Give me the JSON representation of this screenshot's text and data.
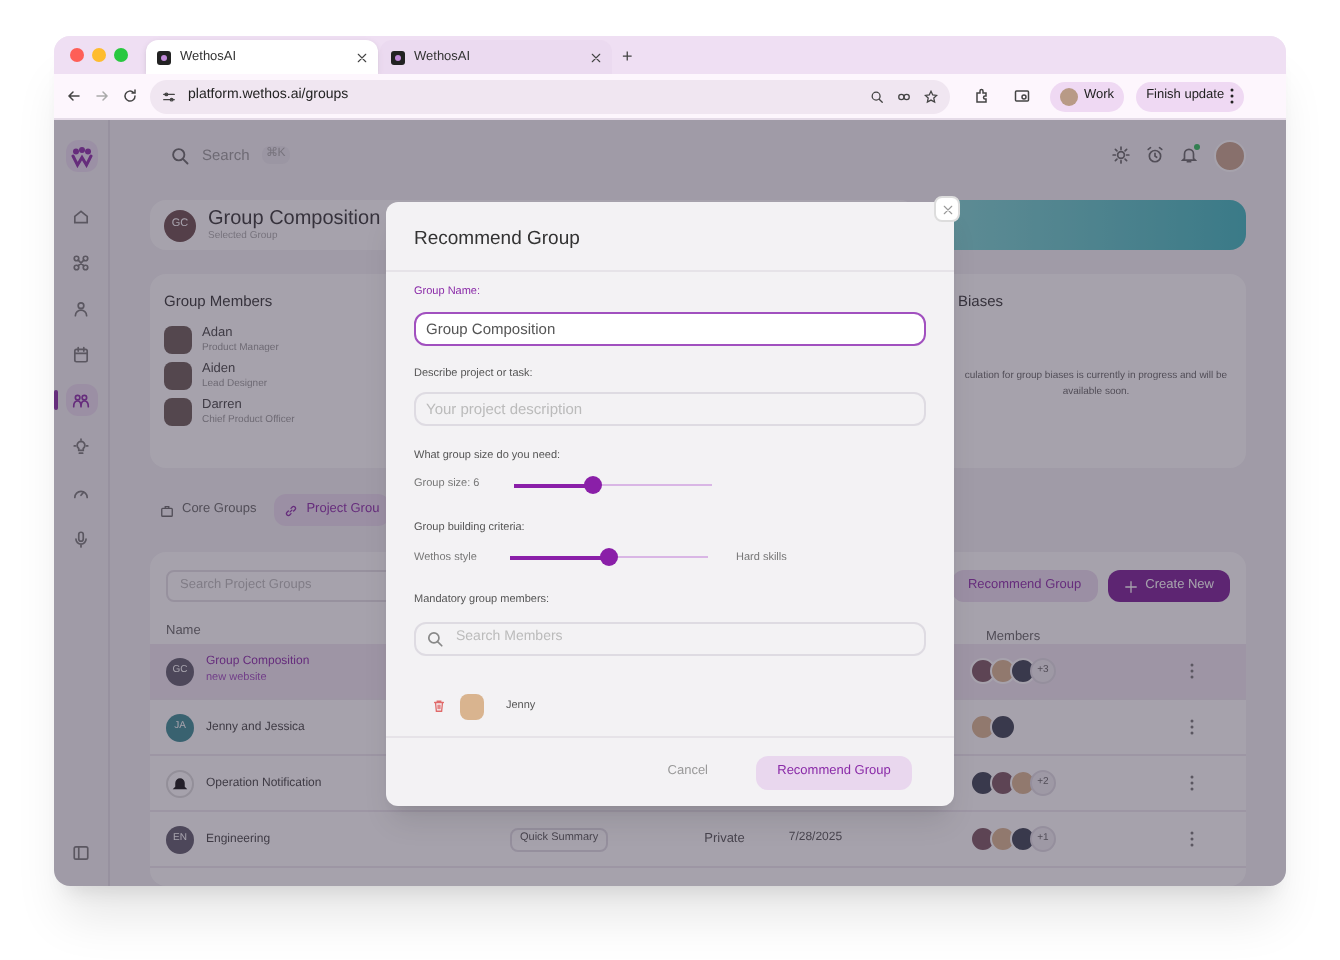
{
  "browser": {
    "tabs": [
      {
        "title": "WethosAI",
        "selected": true
      },
      {
        "title": "WethosAI",
        "selected": false
      }
    ],
    "new_tab": "+",
    "url": "platform.wethos.ai/groups",
    "profile": "Work",
    "update_button": "Finish update"
  },
  "app": {
    "search": {
      "placeholder": "Search",
      "shortcut": "⌘K"
    },
    "sidebar": [
      {
        "kind": "home",
        "selected": false
      },
      {
        "kind": "nodes",
        "selected": false
      },
      {
        "kind": "person",
        "selected": false
      },
      {
        "kind": "calendar",
        "selected": false
      },
      {
        "kind": "people",
        "selected": true
      },
      {
        "kind": "bulb",
        "selected": false
      },
      {
        "kind": "gauge",
        "selected": false
      },
      {
        "kind": "mic",
        "selected": false
      }
    ],
    "selected_group": {
      "initials": "GC",
      "name": "Group Composition",
      "subtitle": "Selected Group"
    },
    "group_members": {
      "title": "Group Members",
      "members": [
        {
          "name": "Adan",
          "role": "Product Manager"
        },
        {
          "name": "Aiden",
          "role": "Lead Designer"
        },
        {
          "name": "Darren",
          "role": "Chief Product Officer"
        }
      ]
    },
    "biases": {
      "title": "Biases",
      "text": "culation for group biases is currently in progress and will be available soon."
    },
    "group_tabs": [
      {
        "label": "Core Groups",
        "selected": false
      },
      {
        "label": "Project Grou",
        "selected": true
      }
    ],
    "table": {
      "search_placeholder": "Search Project Groups",
      "recommend_button": "Recommend Group",
      "create_button": "Create New",
      "columns": [
        "Name",
        "Members"
      ],
      "rows": [
        {
          "kind": "initials",
          "initials": "GC",
          "name": "Group Composition",
          "subtitle": "new website",
          "selected": true,
          "member_photos": [
            {
              "kind": "photo"
            },
            {
              "kind": "photo"
            },
            {
              "kind": "photo"
            }
          ],
          "extra": "+3"
        },
        {
          "kind": "initials",
          "initials": "JA",
          "name": "Jenny and Jessica",
          "selected": false,
          "member_photos": [
            {
              "kind": "photo"
            },
            {
              "kind": "photo"
            }
          ]
        },
        {
          "kind": "bell",
          "name": "Operation Notification",
          "selected": false,
          "member_photos": [
            {
              "kind": "photo"
            },
            {
              "kind": "photo"
            },
            {
              "kind": "photo"
            }
          ],
          "extra": "+2"
        },
        {
          "kind": "initials",
          "initials": "EN",
          "name": "Engineering",
          "selected": false,
          "summary": "Quick Summary",
          "privacy": "Private",
          "date": "7/28/2025",
          "member_photos": [
            {
              "kind": "photo"
            },
            {
              "kind": "photo"
            },
            {
              "kind": "photo"
            }
          ],
          "extra": "+1"
        }
      ]
    }
  },
  "modal": {
    "title": "Recommend Group",
    "group_name": {
      "label": "Group Name:",
      "value": "Group Composition"
    },
    "description": {
      "label": "Describe project or task:",
      "placeholder": "Your project description"
    },
    "group_size": {
      "label": "What group size do you need:",
      "reading": "Group size: 6",
      "level": 0.4
    },
    "criteria": {
      "label": "Group building criteria:",
      "left": "Wethos style",
      "right": "Hard skills",
      "level": 0.5
    },
    "mandatory": {
      "label": "Mandatory group members:",
      "placeholder": "Search Members",
      "members": [
        {
          "name": "Jenny"
        }
      ]
    },
    "cancel": "Cancel",
    "submit": "Recommend Group"
  }
}
